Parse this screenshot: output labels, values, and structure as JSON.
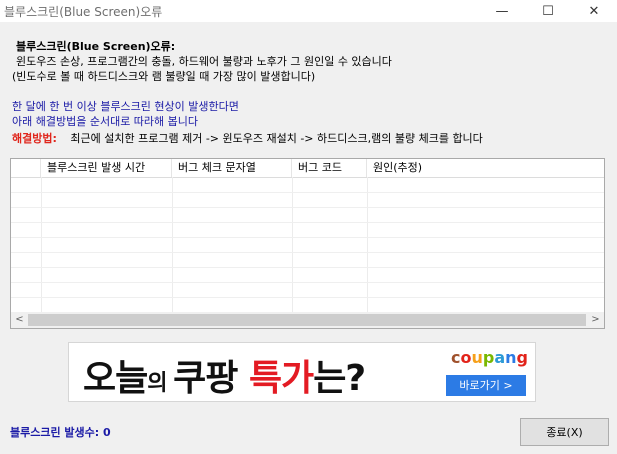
{
  "window": {
    "title": "블루스크린(Blue Screen)오류",
    "minimize_icon": "—",
    "maximize_icon": "☐",
    "close_icon": "✕"
  },
  "description": {
    "heading": "블루스크린(Blue Screen)오류:",
    "line1": "윈도우즈 손상, 프로그램간의 충돌, 하드웨어 불량과 노후가 그 원인일 수 있습니다",
    "line2": "(빈도수로 볼 때 하드디스크와 램 불량일 때 가장 많이 발생합니다)",
    "info1": "한 달에 한 번 이상 블루스크린 현상이 발생한다면",
    "info2": "아래 해결방법을 순서대로 따라해 봅니다",
    "solution_label": "해결방법:",
    "solution_text": "최근에 설치한 프로그램 제거 -> 윈도우즈 재설치 -> 하드디스크,램의 불량 체크를 합니다"
  },
  "table": {
    "columns": [
      "",
      "블루스크린 발생 시간",
      "버그 체크 문자열",
      "버그 코드",
      "원인(추정)"
    ],
    "rows": []
  },
  "scrollbar": {
    "left_arrow": "<",
    "right_arrow": ">"
  },
  "ad": {
    "text_part1": "오늘",
    "text_part2": "의 ",
    "text_part3": "쿠팡 ",
    "text_part4": "특가",
    "text_part5": "는?",
    "brand": "coupang",
    "button": "바로가기 >"
  },
  "footer": {
    "count_label": "블루스크린 발생수: 0",
    "exit_button": "종료(X)"
  }
}
